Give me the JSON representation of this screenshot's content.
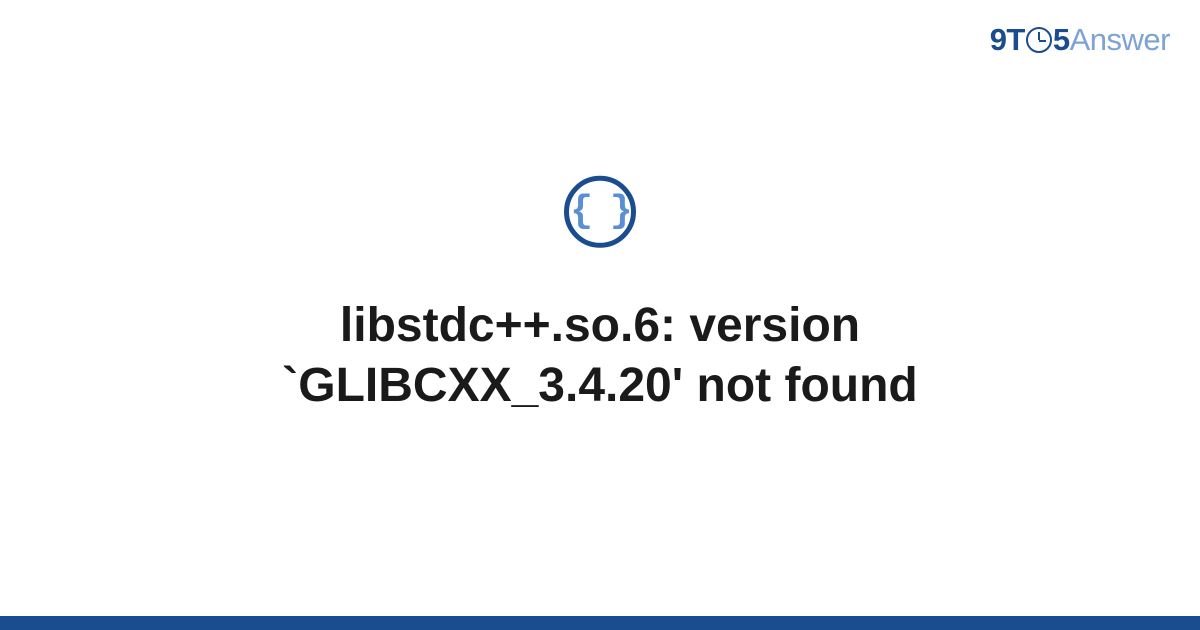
{
  "logo": {
    "part1": "9T",
    "part2": "5",
    "part3": "Answer"
  },
  "icon": {
    "name": "code-braces-icon",
    "glyph": "{ }"
  },
  "title": {
    "line1": "libstdc++.so.6: version",
    "line2": "`GLIBCXX_3.4.20' not found"
  },
  "colors": {
    "brand_dark": "#1a4d8f",
    "brand_light": "#7da3d4",
    "brace_color": "#5b8fd4",
    "text": "#1a1a1a"
  }
}
